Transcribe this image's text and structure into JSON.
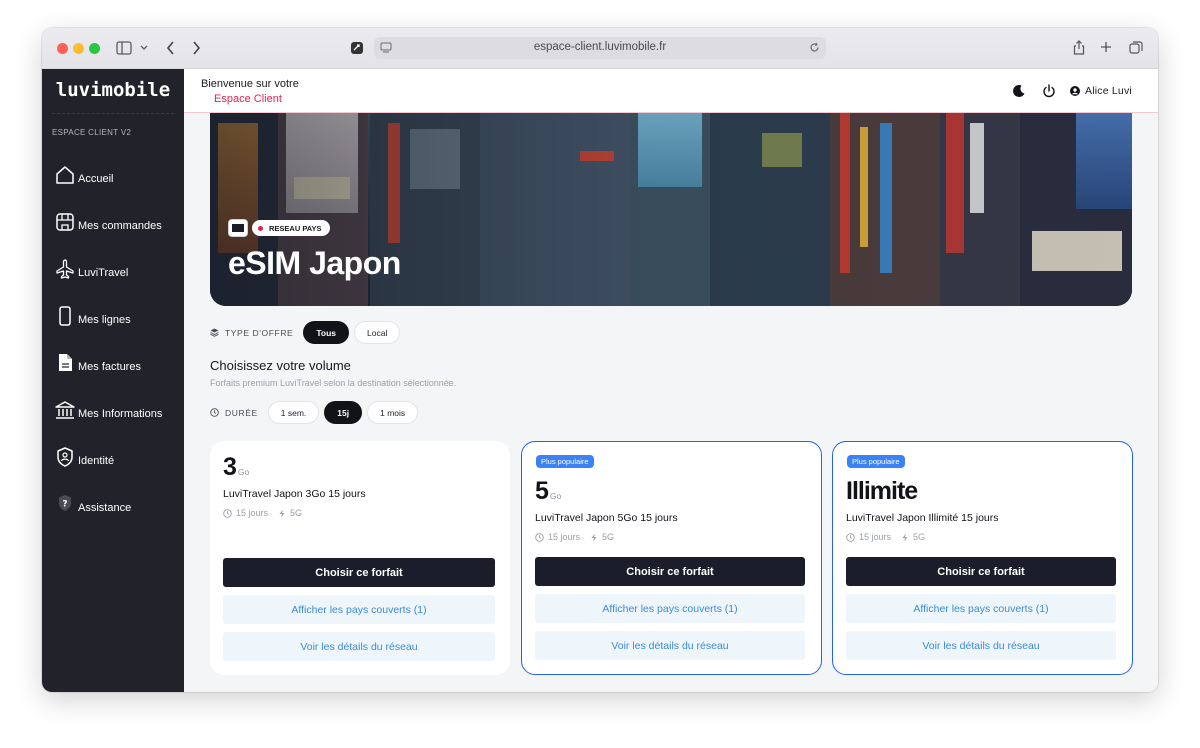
{
  "browser": {
    "url": "espace-client.luvimobile.fr"
  },
  "sidebar": {
    "logo": "luvimobile",
    "caption": "ESPACE CLIENT V2",
    "items": [
      {
        "label": "Accueil",
        "icon": "home-icon"
      },
      {
        "label": "Mes commandes",
        "icon": "shop-icon"
      },
      {
        "label": "LuviTravel",
        "icon": "plane-icon"
      },
      {
        "label": "Mes lignes",
        "icon": "phone-icon"
      },
      {
        "label": "Mes factures",
        "icon": "invoice-icon"
      },
      {
        "label": "Mes Informations",
        "icon": "bank-icon"
      },
      {
        "label": "Identité",
        "icon": "id-shield-icon"
      },
      {
        "label": "Assistance",
        "icon": "help-icon"
      }
    ]
  },
  "header": {
    "welcome": "Bienvenue sur votre",
    "welcome_accent": "Espace Client",
    "user_name": "Alice Luvi"
  },
  "hero": {
    "badge": "RESEAU PAYS",
    "title": "eSIM Japon"
  },
  "offer_filter": {
    "label": "TYPE D'OFFRE",
    "options": [
      "Tous",
      "Local"
    ],
    "selected": "Tous"
  },
  "volume": {
    "title": "Choisissez votre volume",
    "subtitle": "Forfaits premium LuviTravel selon la destination sélectionnée."
  },
  "duration_filter": {
    "label": "DURÉE",
    "options": [
      "1 sem.",
      "15j",
      "1 mois"
    ],
    "selected": "15j"
  },
  "plans": [
    {
      "volume": "3",
      "unit": "Go",
      "name": "LuviTravel Japon 3Go 15 jours",
      "duration": "15 jours",
      "network": "5G",
      "popular": false,
      "badge": "",
      "cta": "Choisir ce forfait",
      "countries": "Afficher les pays couverts (1)",
      "details": "Voir les détails du réseau"
    },
    {
      "volume": "5",
      "unit": "Go",
      "name": "LuviTravel Japon 5Go 15 jours",
      "duration": "15 jours",
      "network": "5G",
      "popular": true,
      "badge": "Plus populaire",
      "cta": "Choisir ce forfait",
      "countries": "Afficher les pays couverts (1)",
      "details": "Voir les détails du réseau"
    },
    {
      "volume": "Illimite",
      "unit": "",
      "name": "LuviTravel Japon Illimité 15 jours",
      "duration": "15 jours",
      "network": "5G",
      "popular": true,
      "badge": "Plus populaire",
      "cta": "Choisir ce forfait",
      "countries": "Afficher les pays couverts (1)",
      "details": "Voir les détails du réseau"
    }
  ],
  "colors": {
    "accent": "#e0244e",
    "sidebar_bg": "#22222a",
    "primary_button": "#1b1d2a",
    "highlight_border": "#2563eb",
    "link": "#3b8bd9"
  }
}
